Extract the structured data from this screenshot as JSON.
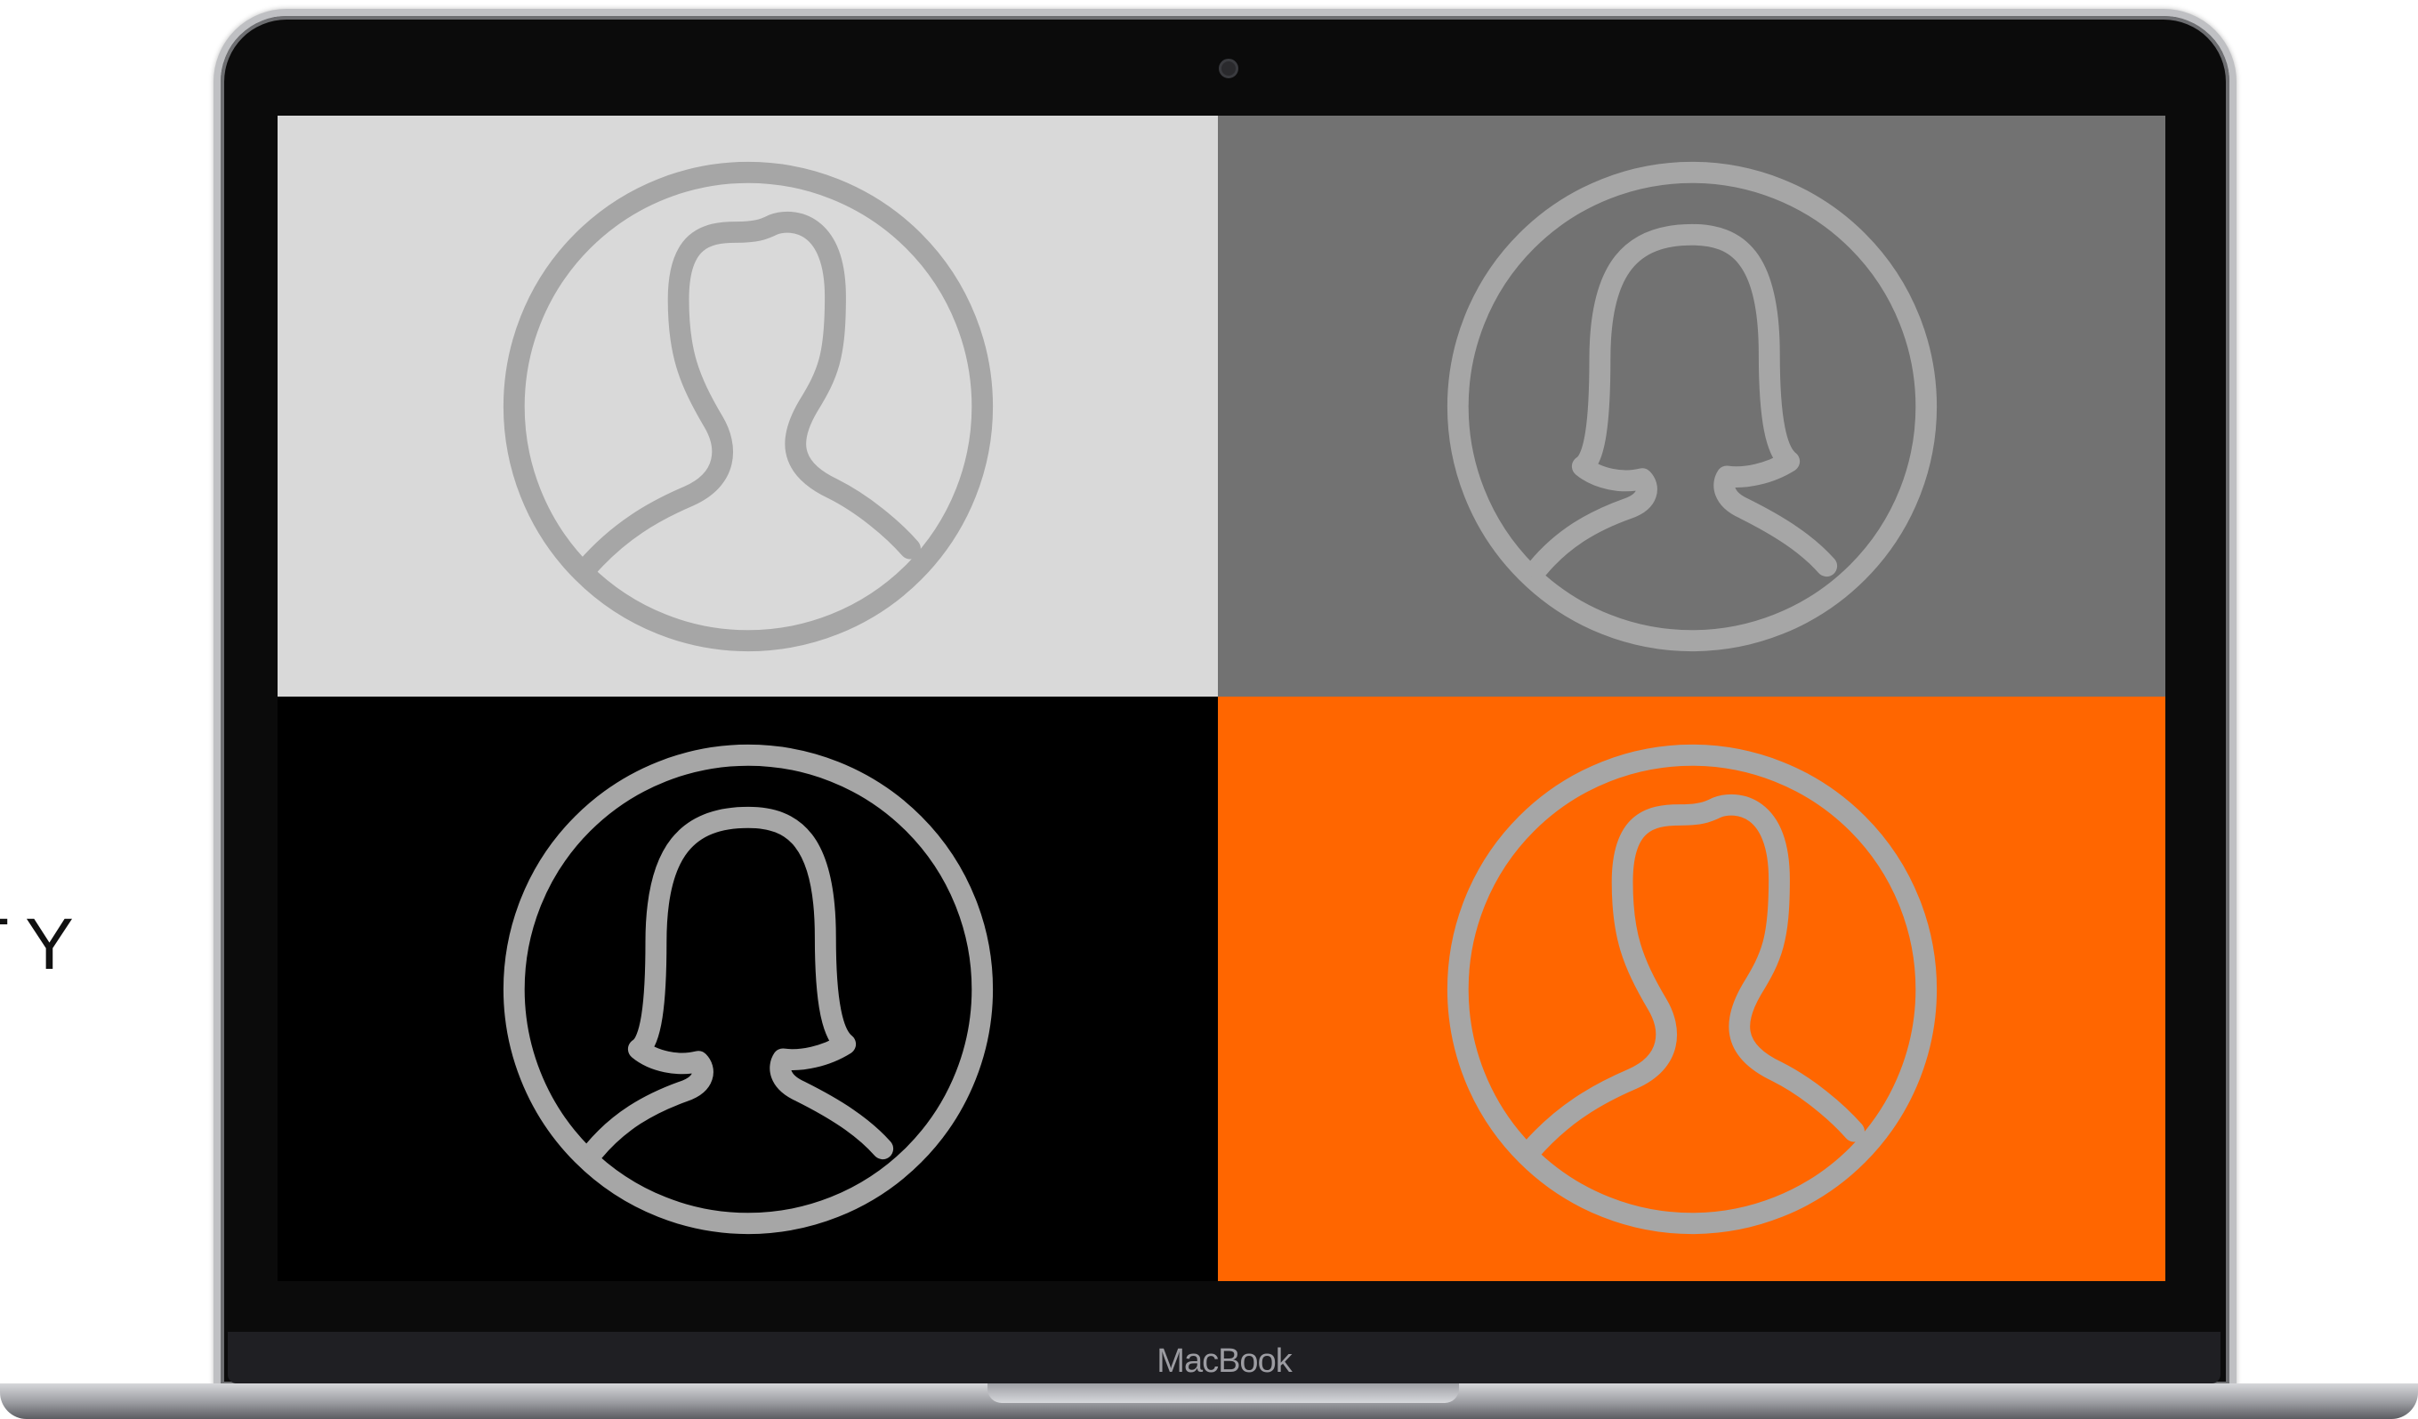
{
  "side_text": "TY",
  "brand_label": "MacBook",
  "tiles": [
    {
      "name": "tile-top-left",
      "background": "#d9d9d9",
      "avatar": "person-short-hair-icon"
    },
    {
      "name": "tile-top-right",
      "background": "#727272",
      "avatar": "person-long-hair-icon"
    },
    {
      "name": "tile-bottom-left",
      "background": "#000000",
      "avatar": "person-long-hair-icon"
    },
    {
      "name": "tile-bottom-right",
      "background": "#ff6600",
      "avatar": "person-short-hair-icon"
    }
  ],
  "colors": {
    "avatar_stroke": "#a6a6a6",
    "accent": "#ff6600"
  }
}
